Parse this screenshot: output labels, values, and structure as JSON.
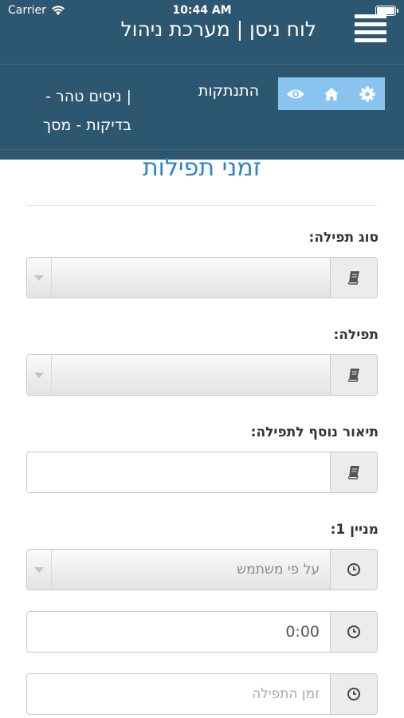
{
  "status_bar": {
    "carrier": "Carrier",
    "time": "10:44 AM"
  },
  "header": {
    "title": "לוח ניסן | מערכת ניהול",
    "user_line1": "| ניסים טהר -",
    "user_line2": "בדיקות - מסך",
    "logout": "התנתקות"
  },
  "page": {
    "title": "זמני תפילות"
  },
  "form": {
    "prayer_type": {
      "label": "סוג תפילה:",
      "value": ""
    },
    "prayer": {
      "label": "תפילה:",
      "value": ""
    },
    "description": {
      "label": "תיאור נוסף לתפילה:",
      "value": ""
    },
    "minyan1": {
      "label": "מניין 1:",
      "mode_value": "על פי משתמש",
      "time_value": "0:00",
      "prayer_time_placeholder": "זמן התפילה"
    }
  },
  "colors": {
    "header_bg": "#2d5770",
    "accent": "#2d85c7",
    "icon_box": "#88c4ef"
  },
  "icons": [
    "wifi-icon",
    "battery-icon",
    "menu-icon",
    "settings-icon",
    "home-icon",
    "eye-icon",
    "book-icon",
    "clock-icon",
    "caret-down-icon"
  ]
}
